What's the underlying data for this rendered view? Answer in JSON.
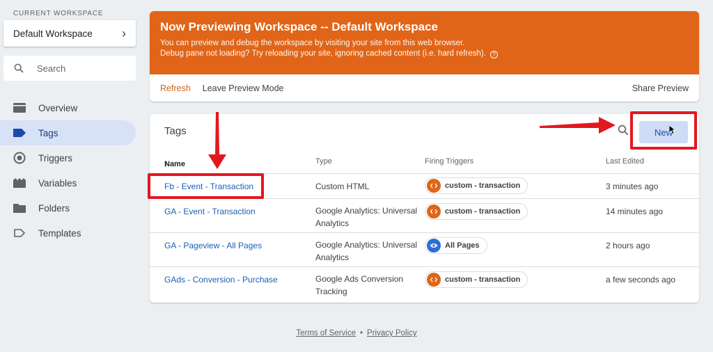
{
  "sidebar": {
    "workspace_label": "CURRENT WORKSPACE",
    "workspace_name": "Default Workspace",
    "search_placeholder": "Search",
    "items": [
      {
        "label": "Overview",
        "icon": "overview-icon"
      },
      {
        "label": "Tags",
        "icon": "tag-icon",
        "active": true
      },
      {
        "label": "Triggers",
        "icon": "trigger-icon"
      },
      {
        "label": "Variables",
        "icon": "variables-icon"
      },
      {
        "label": "Folders",
        "icon": "folder-icon"
      },
      {
        "label": "Templates",
        "icon": "template-icon"
      }
    ]
  },
  "preview": {
    "title": "Now Previewing Workspace -- Default Workspace",
    "line1": "You can preview and debug the workspace by visiting your site from this web browser.",
    "line2": "Debug pane not loading? Try reloading your site, ignoring cached content (i.e. hard refresh).",
    "refresh": "Refresh",
    "leave": "Leave Preview Mode",
    "share": "Share Preview",
    "banner_color": "#e06518"
  },
  "tags": {
    "title": "Tags",
    "new_label": "New",
    "columns": {
      "name": "Name",
      "sort_indicator": "↑",
      "type": "Type",
      "triggers": "Firing Triggers",
      "edited": "Last Edited"
    },
    "rows": [
      {
        "name": "Fb - Event - Transaction",
        "type": "Custom HTML",
        "type2": "",
        "trigger": "custom - transaction",
        "trigger_icon": "code-icon",
        "edited": "3 minutes ago"
      },
      {
        "name": "GA - Event - Transaction",
        "type": "Google Analytics: Universal",
        "type2": "Analytics",
        "trigger": "custom - transaction",
        "trigger_icon": "code-icon",
        "edited": "14 minutes ago"
      },
      {
        "name": "GA - Pageview - All Pages",
        "type": "Google Analytics: Universal",
        "type2": "Analytics",
        "trigger": "All Pages",
        "trigger_icon": "eye-icon",
        "edited": "2 hours ago"
      },
      {
        "name": "GAds - Conversion - Purchase",
        "type": "Google Ads Conversion",
        "type2": "Tracking",
        "trigger": "custom - transaction",
        "trigger_icon": "code-icon",
        "edited": "a few seconds ago"
      }
    ]
  },
  "footer": {
    "terms": "Terms of Service",
    "separator": "•",
    "privacy": "Privacy Policy"
  },
  "annotation_color": "#e3181f"
}
